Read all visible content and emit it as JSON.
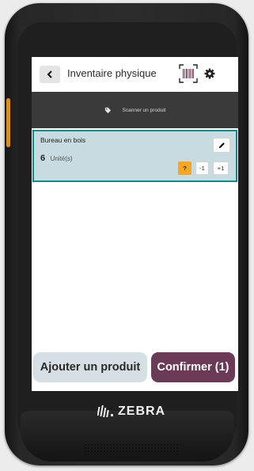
{
  "header": {
    "title": "Inventaire physique",
    "back_icon": "chevron-left-icon",
    "barcode_icon": "barcode-scan-icon",
    "settings_icon": "gear-icon"
  },
  "scan_bar": {
    "label": "Scanner un produit",
    "icon": "tag-icon"
  },
  "product": {
    "name": "Bureau en bois",
    "quantity": "6",
    "unit": "Unité(s)",
    "edit_icon": "pencil-icon",
    "actions": [
      "?",
      "-1",
      "+1"
    ]
  },
  "footer": {
    "add_label": "Ajouter un produit",
    "confirm_label": "Confirmer (1)"
  },
  "device": {
    "brand": "ZEBRA"
  },
  "colors": {
    "accent": "#6b3a56",
    "selected_border": "#0e8a8a",
    "warning": "#f5a623",
    "scan_bar": "#3a3a3a"
  }
}
